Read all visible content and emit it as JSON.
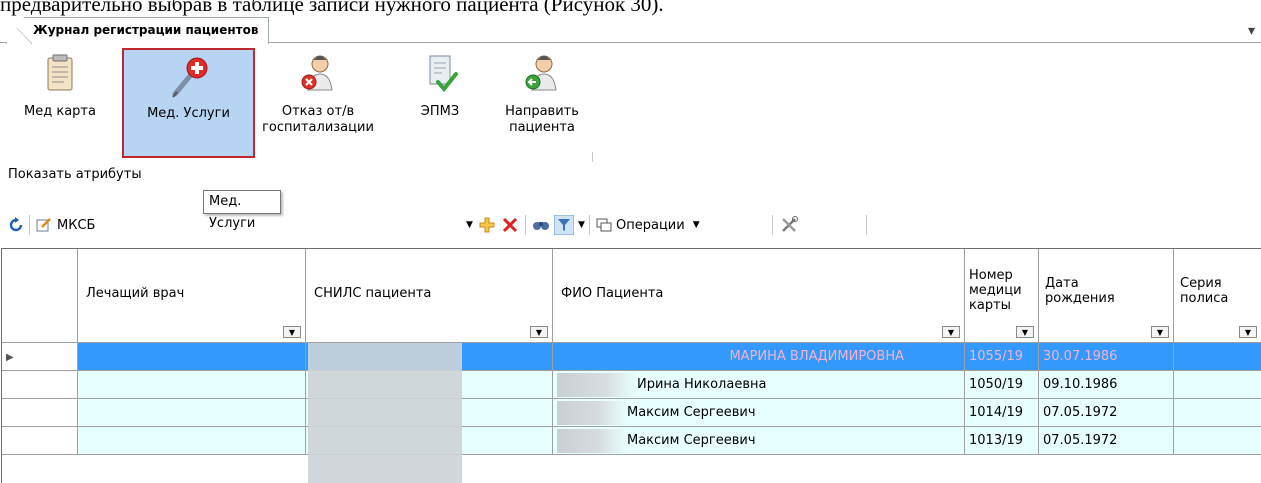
{
  "doc_text": "предварительно выбрав в таблице записи нужного пациента (Рисунок 30).",
  "tab": {
    "title": "Журнал регистрации пациентов"
  },
  "ribbon": {
    "buttons": [
      {
        "label": "Мед карта",
        "icon": "medcard-icon"
      },
      {
        "label": "Мед. Услуги",
        "icon": "syringe-icon",
        "active": true
      },
      {
        "label_line1": "Отказ от/в",
        "label_line2": "госпитализации",
        "icon": "doctor-cancel-icon"
      },
      {
        "label": "ЭПМЗ",
        "icon": "document-check-icon"
      },
      {
        "label_line1": "Направить",
        "label_line2": "пациента",
        "icon": "doctor-refer-icon"
      }
    ]
  },
  "show_attributes": "Показать атрибуты",
  "tooltip": "Мед. Услуги",
  "toolbar": {
    "filter_value": "МКСБ",
    "operations_label": "Операции"
  },
  "grid": {
    "columns": [
      "Лечащий врач",
      "СНИЛС пациента",
      "ФИО Пациента",
      "Номер медицинской карты",
      "Дата рождения",
      "Серия полиса"
    ],
    "header_lines": {
      "medcard": [
        "Номер",
        "медици",
        "карты"
      ],
      "birth": [
        "Дата",
        "рождения"
      ],
      "policy": [
        "Серия",
        "полиса"
      ]
    },
    "rows": [
      {
        "fio": "МАРИНА ВЛАДИМИРОВНА",
        "card": "1055/19",
        "birth": "30.07.1986",
        "selected": true
      },
      {
        "fio": "Ирина Николаевна",
        "card": "1050/19",
        "birth": "09.10.1986"
      },
      {
        "fio": "Максим Сергеевич",
        "card": "1014/19",
        "birth": "07.05.1972"
      },
      {
        "fio": "Максим Сергеевич",
        "card": "1013/19",
        "birth": "07.05.1972"
      }
    ]
  },
  "colors": {
    "selection": "#3399ff",
    "row_bg": "#e8ffff",
    "active_button": "#b7d5f2",
    "active_border": "#c0282d"
  }
}
